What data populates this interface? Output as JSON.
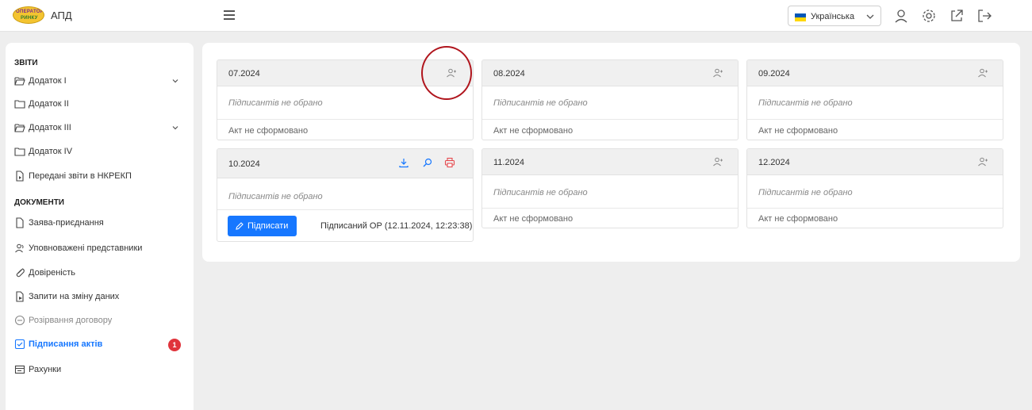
{
  "header": {
    "app_title": "АПД",
    "logo": {
      "line1": "ОПЕРАТОР",
      "line2": "РИНКУ"
    },
    "language": "Українська",
    "icons": [
      "menu-icon",
      "user-icon",
      "settings-icon",
      "external-link-icon",
      "logout-icon"
    ]
  },
  "sidebar": {
    "sections": [
      {
        "title": "ЗВІТИ",
        "items": [
          {
            "label": "Додаток I",
            "icon": "folder-open-icon",
            "expandable": true
          },
          {
            "label": "Додаток II",
            "icon": "folder-icon"
          },
          {
            "label": "Додаток III",
            "icon": "folder-open-icon",
            "expandable": true
          },
          {
            "label": "Додаток IV",
            "icon": "folder-icon"
          },
          {
            "label": "Передані звіти в НКРЕКП",
            "icon": "file-send-icon"
          }
        ]
      },
      {
        "title": "ДОКУМЕНТИ",
        "items": [
          {
            "label": "Заява-приєднання",
            "icon": "file-icon"
          },
          {
            "label": "Уповноважені представники",
            "icon": "users-icon"
          },
          {
            "label": "Довіреність",
            "icon": "paperclip-icon"
          },
          {
            "label": "Запити на зміну даних",
            "icon": "file-edit-icon"
          },
          {
            "label": "Розірвання договору",
            "icon": "minus-circle-icon",
            "disabled": true
          },
          {
            "label": "Підписання актів",
            "icon": "checkbox-icon",
            "active": true,
            "badge": "1"
          },
          {
            "label": "Рахунки",
            "icon": "invoice-icon"
          }
        ]
      }
    ]
  },
  "cards": [
    {
      "period": "07.2024",
      "signers": "Підписантів не обрано",
      "act_status": "Акт не сформовано",
      "actions": [
        "assign-signers-icon"
      ],
      "highlighted": true
    },
    {
      "period": "08.2024",
      "signers": "Підписантів не обрано",
      "act_status": "Акт не сформовано",
      "actions": [
        "assign-signers-icon"
      ]
    },
    {
      "period": "09.2024",
      "signers": "Підписантів не обрано",
      "act_status": "Акт не сформовано",
      "actions": [
        "assign-signers-icon"
      ]
    },
    {
      "period": "10.2024",
      "signers": "Підписантів не обрано",
      "sign_button": "Підписати",
      "signed_status": "Підписаний ОР (12.11.2024, 12:23:38)",
      "actions": [
        "download-icon",
        "search-icon",
        "print-icon"
      ]
    },
    {
      "period": "11.2024",
      "signers": "Підписантів не обрано",
      "act_status": "Акт не сформовано",
      "actions": [
        "assign-signers-icon"
      ]
    },
    {
      "period": "12.2024",
      "signers": "Підписантів не обрано",
      "act_status": "Акт не сформовано",
      "actions": [
        "assign-signers-icon"
      ]
    }
  ],
  "colors": {
    "accent": "#1677ff",
    "badge": "#e0343c",
    "highlight_ring": "#b0151d",
    "print_icon": "#e5484d"
  }
}
